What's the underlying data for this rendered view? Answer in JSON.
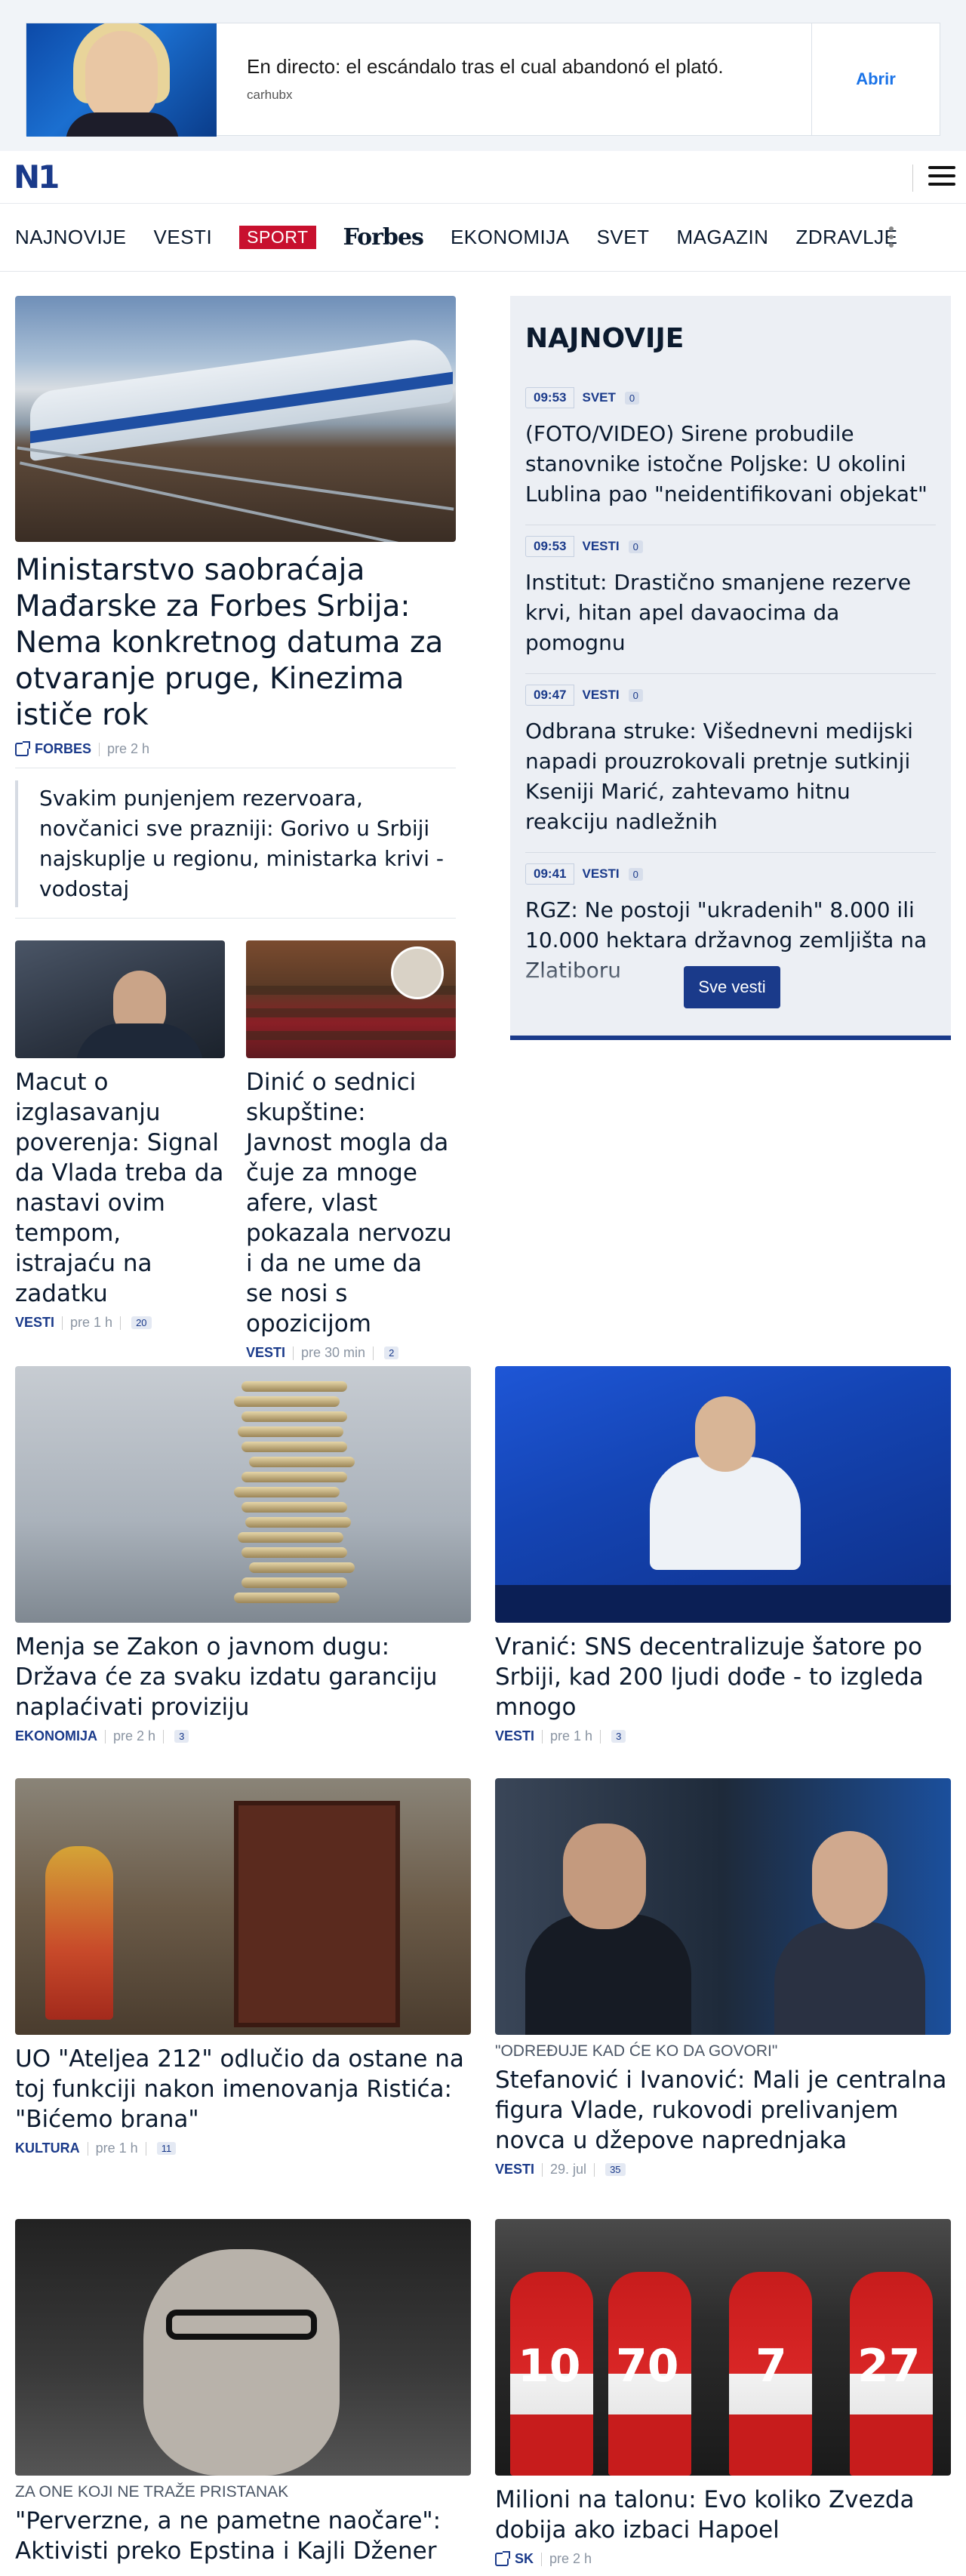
{
  "ad": {
    "title": "En directo: el escándalo tras el cual abandonó el plató.",
    "source": "carhubx",
    "button": "Abrir"
  },
  "header": {
    "logo": "N1"
  },
  "nav": {
    "items": [
      "NAJNOVIJE",
      "VESTI",
      "SPORT",
      "Forbes",
      "EKONOMIJA",
      "SVET",
      "MAGAZIN",
      "ZDRAVLJE"
    ]
  },
  "lead": {
    "title": "Ministarstvo saobraćaja Mađarske za Forbes Srbija: Nema konkretnog datuma za otvaranje pruge, Kinezima ističe rok",
    "category": "FORBES",
    "time": "pre 2 h",
    "related": "Svakim punjenjem rezervoara, novčanici sve prazniji: Gorivo u Srbiji najskuplje u regionu, ministarka krivi - vodostaj"
  },
  "small_cards": [
    {
      "title": "Macut o izglasavanju poverenja: Signal da Vlada treba da nastavi ovim tempom, istrajaću na zadatku",
      "category": "VESTI",
      "time": "pre 1 h",
      "comments": "20"
    },
    {
      "title": "Dinić o sednici skupštine: Javnost mogla da čuje za mnoge afere, vlast pokazala nervozu i da ne ume da se nosi s opozicijom",
      "category": "VESTI",
      "time": "pre 30 min",
      "comments": "2"
    }
  ],
  "sidebar": {
    "title": "NAJNOVIJE",
    "items": [
      {
        "time": "09:53",
        "category": "SVET",
        "comments": "0",
        "text": "(FOTO/VIDEO) Sirene probudile stanovnike istočne Poljske: U okolini Lublina pao \"neidentifikovani objekat\""
      },
      {
        "time": "09:53",
        "category": "VESTI",
        "comments": "0",
        "text": "Institut: Drastično smanjene rezerve krvi, hitan apel davaocima da pomognu"
      },
      {
        "time": "09:47",
        "category": "VESTI",
        "comments": "0",
        "text": "Odbrana struke: Višednevni medijski napadi prouzrokovali pretnje sutkinji Kseniji Marić, zahtevamo hitnu reakciju nadležnih"
      },
      {
        "time": "09:41",
        "category": "VESTI",
        "comments": "0",
        "text": "RGZ: Ne postoji \"ukradenih\" 8.000 ili 10.000 hektara državnog zemljišta na Zlatiboru"
      }
    ],
    "button": "Sve vesti"
  },
  "grid": [
    {
      "kicker": "",
      "title": "Menja se Zakon o javnom dugu: Država će za svaku izdatu garanciju naplaćivati proviziju",
      "category": "EKONOMIJA",
      "time": "pre 2 h",
      "comments": "3"
    },
    {
      "kicker": "",
      "title": "Vranić: SNS decentralizuje šatore po Srbiji, kad 200 ljudi dođe - to izgleda mnogo",
      "category": "VESTI",
      "time": "pre 1 h",
      "comments": "3"
    },
    {
      "kicker": "",
      "title": "UO \"Ateljea 212\" odlučio da ostane na toj funkciji nakon imenovanja Ristića: \"Bićemo brana\"",
      "category": "KULTURA",
      "time": "pre 1 h",
      "comments": "11"
    },
    {
      "kicker": "\"ODREĐUJE KAD ĆE KO DA GOVORI\"",
      "title": "Stefanović i Ivanović: Mali je centralna figura Vlade, rukovodi prelivanjem novca u džepove naprednjaka",
      "category": "VESTI",
      "time": "29. jul",
      "comments": "35"
    },
    {
      "kicker": "ZA ONE KOJI NE TRAŽE PRISTANAK",
      "title": "\"Perverzne, a ne pametne naočare\": Aktivisti preko Epstina i Kajli Džener",
      "category": "",
      "time": "",
      "comments": ""
    },
    {
      "kicker": "",
      "title": "Milioni na talonu: Evo koliko Zvezda dobija ako izbaci Hapoel",
      "category": "SK",
      "time": "pre 2 h",
      "comments": ""
    }
  ],
  "jersey_numbers": [
    "10",
    "70",
    "7",
    "27"
  ],
  "colors": {
    "brand": "#1a3a8a",
    "sport": "#c8102e",
    "ad_button": "#1a73e8"
  }
}
